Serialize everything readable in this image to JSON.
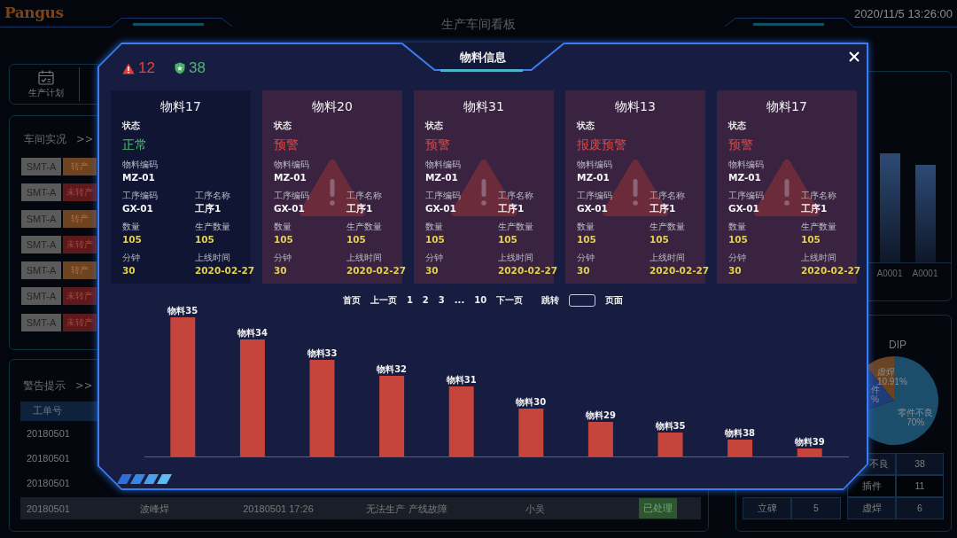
{
  "header": {
    "logo": "Pangus",
    "title": "生产车间看板",
    "datetime": "2020/11/5 13:26:00"
  },
  "nav_tabs": [
    {
      "label": "生产计划"
    }
  ],
  "live_panel": {
    "title": "车间实况",
    "more": ">>",
    "lines": [
      {
        "name": "SMT-A",
        "status": "转产",
        "switched": true
      },
      {
        "name": "SMT-A",
        "status": "未转产",
        "switched": false
      },
      {
        "name": "SMT-A",
        "status": "转产",
        "switched": true
      },
      {
        "name": "SMT-A",
        "status": "未转产",
        "switched": false
      },
      {
        "name": "SMT-A",
        "status": "转产",
        "switched": true
      },
      {
        "name": "SMT-A",
        "status": "未转产",
        "switched": false
      },
      {
        "name": "SMT-A",
        "status": "未转产",
        "switched": false
      }
    ]
  },
  "alert_panel": {
    "title": "警告提示",
    "more": ">>",
    "columns": [
      "工单号"
    ],
    "rows": [
      {
        "cells": [
          "20180501"
        ],
        "selected": false
      },
      {
        "cells": [
          "20180501"
        ],
        "selected": false
      },
      {
        "cells": [
          "20180501"
        ],
        "selected": false
      },
      {
        "cells": [
          "20180501",
          "波峰焊",
          "20180501 17:26",
          "无法生产 产线故障",
          "小吴"
        ],
        "status": "已处理",
        "selected": true
      }
    ]
  },
  "output_panel": {
    "labels": [
      "A0001",
      "A0001"
    ]
  },
  "defect_panel": {
    "chart_data": {
      "type": "pie",
      "title": "DIP",
      "categories": [
        "零件不良",
        "件",
        "虚焊"
      ],
      "values": [
        70,
        19.09,
        10.91
      ],
      "value_labels": [
        "70%",
        "%",
        "10.91%"
      ]
    },
    "rows": [
      {
        "right": {
          "label": "不良",
          "value": "38"
        }
      },
      {
        "right": {
          "label": "插件",
          "value": "11"
        }
      },
      {
        "left": {
          "label": "立碑",
          "value": "5"
        },
        "right": {
          "label": "虚焊",
          "value": "6"
        }
      }
    ]
  },
  "modal": {
    "title": "物料信息",
    "warning_count": "12",
    "normal_count": "38",
    "cards": [
      {
        "title": "物料17",
        "status_label": "状态",
        "status": "正常",
        "alert": false,
        "fields": [
          {
            "label": "物料编码",
            "value": "MZ-01",
            "kind": "code"
          },
          {
            "label": "工序编码",
            "value": "GX-01",
            "kind": "code"
          },
          {
            "label": "工序名称",
            "value": "工序1",
            "kind": "code"
          },
          {
            "label": "数量",
            "value": "105",
            "kind": "figure"
          },
          {
            "label": "生产数量",
            "value": "105",
            "kind": "figure"
          },
          {
            "label": "分钟",
            "value": "30",
            "kind": "figure"
          },
          {
            "label": "上线时间",
            "value": "2020-02-27",
            "kind": "figure"
          }
        ]
      },
      {
        "title": "物料20",
        "status_label": "状态",
        "status": "预警",
        "alert": true,
        "fields": [
          {
            "label": "物料编码",
            "value": "MZ-01",
            "kind": "code"
          },
          {
            "label": "工序编码",
            "value": "GX-01",
            "kind": "code"
          },
          {
            "label": "工序名称",
            "value": "工序1",
            "kind": "code"
          },
          {
            "label": "数量",
            "value": "105",
            "kind": "figure"
          },
          {
            "label": "生产数量",
            "value": "105",
            "kind": "figure"
          },
          {
            "label": "分钟",
            "value": "30",
            "kind": "figure"
          },
          {
            "label": "上线时间",
            "value": "2020-02-27",
            "kind": "figure"
          }
        ]
      },
      {
        "title": "物料31",
        "status_label": "状态",
        "status": "预警",
        "alert": true,
        "fields": [
          {
            "label": "物料编码",
            "value": "MZ-01",
            "kind": "code"
          },
          {
            "label": "工序编码",
            "value": "GX-01",
            "kind": "code"
          },
          {
            "label": "工序名称",
            "value": "工序1",
            "kind": "code"
          },
          {
            "label": "数量",
            "value": "105",
            "kind": "figure"
          },
          {
            "label": "生产数量",
            "value": "105",
            "kind": "figure"
          },
          {
            "label": "分钟",
            "value": "30",
            "kind": "figure"
          },
          {
            "label": "上线时间",
            "value": "2020-02-27",
            "kind": "figure"
          }
        ]
      },
      {
        "title": "物料13",
        "status_label": "状态",
        "status": "报废预警",
        "alert": true,
        "fields": [
          {
            "label": "物料编码",
            "value": "MZ-01",
            "kind": "code"
          },
          {
            "label": "工序编码",
            "value": "GX-01",
            "kind": "code"
          },
          {
            "label": "工序名称",
            "value": "工序1",
            "kind": "code"
          },
          {
            "label": "数量",
            "value": "105",
            "kind": "figure"
          },
          {
            "label": "生产数量",
            "value": "105",
            "kind": "figure"
          },
          {
            "label": "分钟",
            "value": "30",
            "kind": "figure"
          },
          {
            "label": "上线时间",
            "value": "2020-02-27",
            "kind": "figure"
          }
        ]
      },
      {
        "title": "物料17",
        "status_label": "状态",
        "status": "预警",
        "alert": true,
        "fields": [
          {
            "label": "物料编码",
            "value": "MZ-01",
            "kind": "code"
          },
          {
            "label": "工序编码",
            "value": "GX-01",
            "kind": "code"
          },
          {
            "label": "工序名称",
            "value": "工序1",
            "kind": "code"
          },
          {
            "label": "数量",
            "value": "105",
            "kind": "figure"
          },
          {
            "label": "生产数量",
            "value": "105",
            "kind": "figure"
          },
          {
            "label": "分钟",
            "value": "30",
            "kind": "figure"
          },
          {
            "label": "上线时间",
            "value": "2020-02-27",
            "kind": "figure"
          }
        ]
      }
    ],
    "pagination": {
      "pages": [
        "首页",
        "上一页",
        "1",
        "2",
        "3",
        "...",
        "10",
        "下一页"
      ],
      "jump_label": "跳转",
      "unit_label": "页面"
    },
    "chart": {
      "bars": [
        "物料35",
        "物料34",
        "物料33",
        "物料32",
        "物料31",
        "物料30",
        "物料29",
        "物料35",
        "物料38",
        "物料39"
      ]
    }
  }
}
